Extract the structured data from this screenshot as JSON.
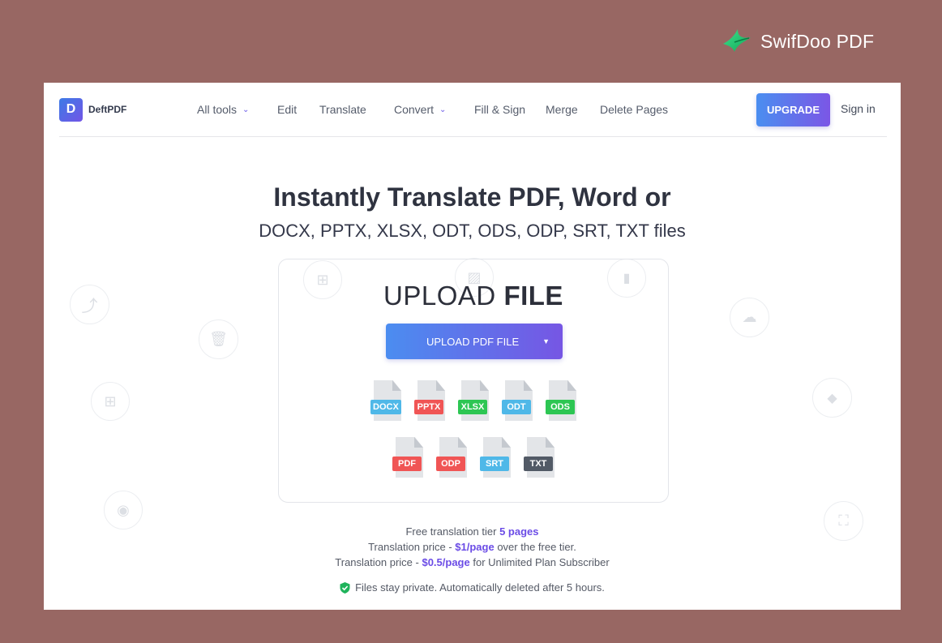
{
  "outer_brand": {
    "name": "SwifDoo PDF",
    "icon": "swift-bird-logo-icon"
  },
  "header": {
    "logo_letter": "D",
    "logo_text": "DeftPDF",
    "nav": [
      {
        "label": "All tools",
        "dropdown": true
      },
      {
        "label": "Edit",
        "dropdown": false
      },
      {
        "label": "Translate",
        "dropdown": false
      },
      {
        "label": "Convert",
        "dropdown": true
      },
      {
        "label": "Fill & Sign",
        "dropdown": false
      },
      {
        "label": "Merge",
        "dropdown": false
      },
      {
        "label": "Delete Pages",
        "dropdown": false
      }
    ],
    "upgrade_label": "UPGRADE",
    "signin_label": "Sign in"
  },
  "hero": {
    "title": "Instantly Translate PDF, Word or",
    "subtitle": "DOCX, PPTX, XLSX, ODT, ODS, ODP, SRT, TXT files"
  },
  "upload": {
    "heading_light": "UPLOAD",
    "heading_bold": "FILE",
    "button_label": "UPLOAD PDF FILE",
    "file_types_row1": [
      {
        "label": "DOCX",
        "color": "#4fb8e8"
      },
      {
        "label": "PPTX",
        "color": "#f05555"
      },
      {
        "label": "XLSX",
        "color": "#2dc653"
      },
      {
        "label": "ODT",
        "color": "#4fb8e8"
      },
      {
        "label": "ODS",
        "color": "#2dc653"
      }
    ],
    "file_types_row2": [
      {
        "label": "PDF",
        "color": "#f05555"
      },
      {
        "label": "ODP",
        "color": "#f05555"
      },
      {
        "label": "SRT",
        "color": "#4fb8e8"
      },
      {
        "label": "TXT",
        "color": "#525a66"
      }
    ]
  },
  "pricing": {
    "line1_text": "Free translation tier",
    "line1_highlight": "5 pages",
    "line2_pre": "Translation price -",
    "line2_highlight": "$1/page",
    "line2_post": "over the free tier.",
    "line3_pre": "Translation price -",
    "line3_highlight": "$0.5/page",
    "line3_post": "for Unlimited Plan Subscriber"
  },
  "privacy": {
    "icon": "shield-check-icon",
    "text": "Files stay private. Automatically deleted after 5 hours."
  },
  "colors": {
    "background": "#986763",
    "accent_start": "#4a8ef0",
    "accent_end": "#7b56e6",
    "highlight": "#6b4ce6"
  }
}
